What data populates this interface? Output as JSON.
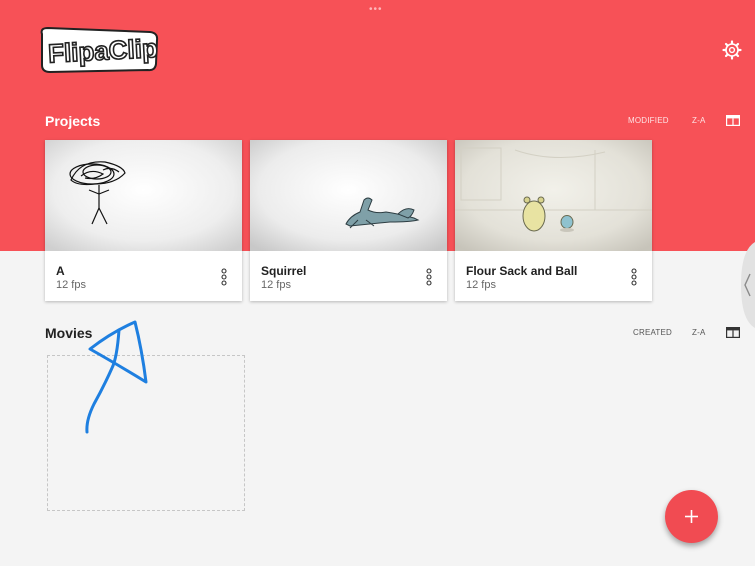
{
  "app": {
    "name": "FlipaClip",
    "logo_text": "FlipaClip",
    "brand_color": "#f75157"
  },
  "header": {
    "settings_icon": "gear-icon"
  },
  "projects": {
    "title": "Projects",
    "sort_label": "MODIFIED",
    "order_label": "Z-A",
    "view_icon": "layout-grid-icon",
    "items": [
      {
        "title": "A",
        "fps": "12 fps",
        "menu_icon": "more-vertical-icon"
      },
      {
        "title": "Squirrel",
        "fps": "12 fps",
        "menu_icon": "more-vertical-icon"
      },
      {
        "title": "Flour Sack and Ball",
        "fps": "12 fps",
        "menu_icon": "more-vertical-icon"
      }
    ]
  },
  "movies": {
    "title": "Movies",
    "sort_label": "CREATED",
    "order_label": "Z-A",
    "view_icon": "layout-grid-icon"
  },
  "fab": {
    "icon": "plus-icon",
    "color": "#f14b52"
  },
  "annotation": {
    "color": "#1e7fe0",
    "icon": "hand-drawn-arrow"
  }
}
